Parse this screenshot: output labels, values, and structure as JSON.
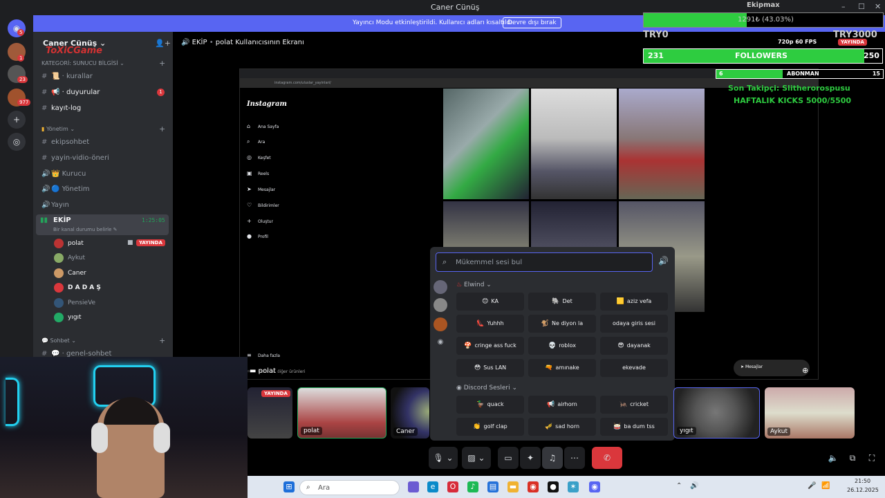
{
  "titlebar": {
    "title": "Caner Cünüş",
    "wc_min": "–",
    "wc_max": "☐",
    "wc_close": "✕"
  },
  "notice": {
    "text": "Yayıncı Modu etkinleştirildi. Kullanıcı adları kısaltıldı.",
    "button": "Devre dışı bırak"
  },
  "servers": {
    "badges": [
      "5",
      "1",
      "23",
      "977"
    ]
  },
  "sidebar": {
    "server_name": "Caner Cünüş ⌄",
    "watermark": "ToXiCGame",
    "categories": [
      {
        "label": "KATEGORİ: SUNUCU BİLGİSİ ⌄"
      },
      {
        "label": "Yönetim ⌄"
      },
      {
        "label": "Sohbet ⌄"
      }
    ],
    "channels": [
      {
        "label": "📜 · kurallar"
      },
      {
        "label": "📢 · duyurular",
        "badge": "1"
      },
      {
        "label": "kayıt-log"
      },
      {
        "label": "ekipsohbet"
      },
      {
        "label": "yayin-vidio-öneri"
      },
      {
        "label": "👑 Kurucu"
      },
      {
        "label": "🔵 Yönetim"
      },
      {
        "label": "Yayın"
      },
      {
        "label": "💬 · genel-sohbet"
      }
    ],
    "active_voice": {
      "name": "EKİP",
      "timer": "1:25:05",
      "status": "Bir kanal durumu belirle ✎"
    },
    "members": [
      {
        "name": "polat",
        "live": "YAYINDA"
      },
      {
        "name": "Aykut"
      },
      {
        "name": "Caner"
      },
      {
        "name": "D A D A Ş"
      },
      {
        "name": "PensieVe"
      },
      {
        "name": "yıgıt"
      }
    ]
  },
  "stage": {
    "channel": "EKİP",
    "screen_title": "polat Kullanıcısının Ekranı"
  },
  "browser": {
    "url": "instagram.com/uluslar_yayinlari/",
    "logo": "Instagram",
    "nav": [
      "Ana Sayfa",
      "Ara",
      "Keşfet",
      "Reels",
      "Mesajlar",
      "Bildirimler",
      "Oluştur",
      "Profil",
      "Daha fazla",
      "Meta'nın diğer ürünleri"
    ],
    "messages_btn": "Mesajlar"
  },
  "overlay": {
    "top_label": "Ekipmax",
    "progress_text": "1291₺ (43.03%)",
    "progress_fraction": 0.4303,
    "try_left": "TRY0",
    "try_right": "TRY3000",
    "quality": "720p 60 FPS",
    "live": "YAYINDA",
    "followers_current": "231",
    "followers_label": "FOLLOWERS",
    "followers_goal": "250",
    "sub_current": "6",
    "sub_label": "ABONMAN",
    "sub_goal": "15",
    "last_follower": "Son Takipçi: Slitherorospusu",
    "weekly_kicks": "HAFTALIK KICKS 5000/5500"
  },
  "soundboard": {
    "search_placeholder": "Mükemmel sesi bul",
    "section1": "Elwind ⌄",
    "section2": "Discord Sesleri ⌄",
    "sounds1": [
      {
        "label": "KA",
        "emoji": "😊"
      },
      {
        "label": "Det",
        "emoji": "🐘"
      },
      {
        "label": "aziz vefa",
        "emoji": "🟨"
      },
      {
        "label": "Yuhhh",
        "emoji": "👠"
      },
      {
        "label": "Ne diyon la",
        "emoji": "🐒"
      },
      {
        "label": "odaya giris sesi",
        "emoji": ""
      },
      {
        "label": "cringe ass fuck",
        "emoji": "🍄"
      },
      {
        "label": "roblox",
        "emoji": "💀"
      },
      {
        "label": "dayanak",
        "emoji": "😎"
      },
      {
        "label": "Sus LAN",
        "emoji": "😳"
      },
      {
        "label": "amınake",
        "emoji": "🔫"
      },
      {
        "label": "ekevade",
        "emoji": ""
      }
    ],
    "sounds2": [
      {
        "label": "quack",
        "emoji": "🦆"
      },
      {
        "label": "airhorn",
        "emoji": "📢"
      },
      {
        "label": "cricket",
        "emoji": "🦗"
      },
      {
        "label": "golf clap",
        "emoji": "👏"
      },
      {
        "label": "sad horn",
        "emoji": "🎺"
      },
      {
        "label": "ba dum tss",
        "emoji": "🥁"
      }
    ]
  },
  "screen_owner_label": "polat",
  "tiles": [
    {
      "label": "YAYINDA"
    },
    {
      "label": "polat"
    },
    {
      "label": "Caner"
    },
    {
      "label": "yıgıt"
    },
    {
      "label": "Aykut"
    }
  ],
  "taskbar": {
    "search": "Ara",
    "time": "21:50",
    "date": "26.12.2025"
  }
}
